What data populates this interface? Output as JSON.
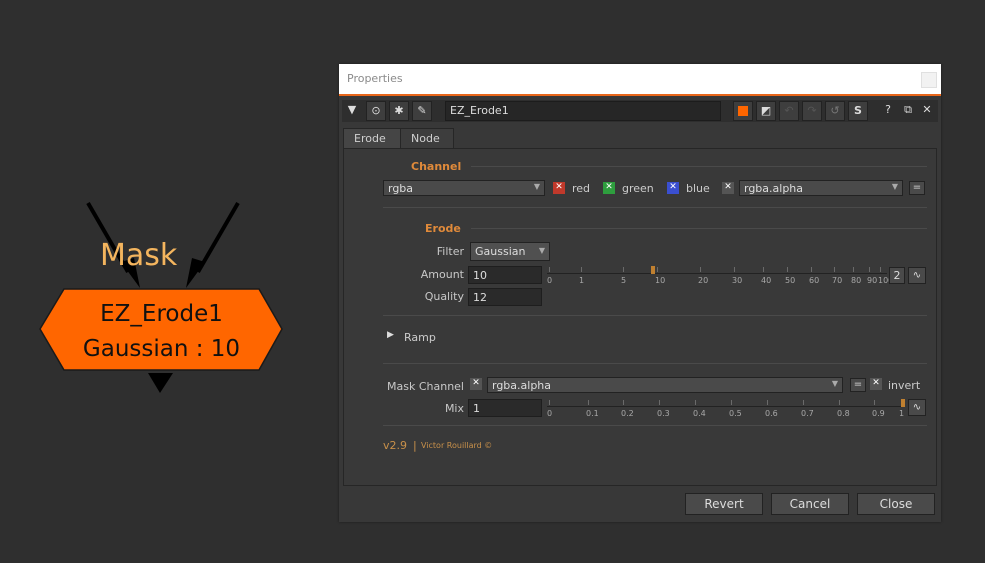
{
  "graph": {
    "mask_label": "Mask",
    "node": {
      "name": "EZ_Erode1",
      "subtitle": "Gaussian : 10",
      "fill": "#ff6600"
    }
  },
  "properties": {
    "title": "Properties",
    "node_name": "EZ_Erode1",
    "tabs": [
      {
        "label": "Erode",
        "active": true
      },
      {
        "label": "Node",
        "active": false
      }
    ],
    "channel_section": {
      "title": "Channel",
      "channel_select": "rgba",
      "checks": [
        {
          "label": "red",
          "color": "#c0392b"
        },
        {
          "label": "green",
          "color": "#2e9e3e"
        },
        {
          "label": "blue",
          "color": "#3a4fd0"
        }
      ],
      "alpha_select": "rgba.alpha",
      "eq_button": "="
    },
    "erode_section": {
      "title": "Erode",
      "filter_label": "Filter",
      "filter_value": "Gaussian",
      "amount_label": "Amount",
      "amount_value": "10",
      "amount_ticks": [
        "0",
        "1",
        "5",
        "10",
        "20",
        "30",
        "40",
        "50",
        "60",
        "70",
        "80",
        "90",
        "100"
      ],
      "amount_btn": "2",
      "quality_label": "Quality",
      "quality_value": "12"
    },
    "ramp_label": "Ramp",
    "mask_section": {
      "mask_channel_label": "Mask Channel",
      "mask_channel_value": "rgba.alpha",
      "eq_button": "=",
      "invert_label": "invert",
      "mix_label": "Mix",
      "mix_value": "1",
      "mix_ticks": [
        "0",
        "0.1",
        "0.2",
        "0.3",
        "0.4",
        "0.5",
        "0.6",
        "0.7",
        "0.8",
        "0.9",
        "1"
      ]
    },
    "version": "v2.9",
    "separator": "|",
    "credit": "Victor Rouillard ©",
    "buttons": {
      "revert": "Revert",
      "cancel": "Cancel",
      "close": "Close"
    },
    "accent": "#e8661a"
  }
}
